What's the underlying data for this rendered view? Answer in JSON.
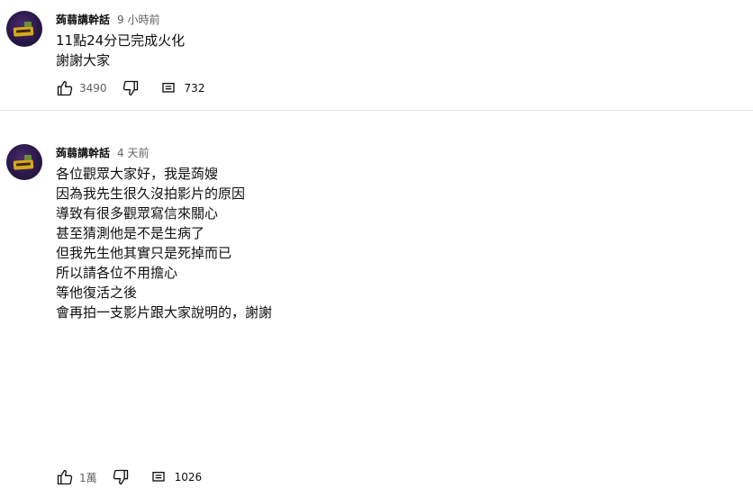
{
  "comments": [
    {
      "author": "蒟蒻講幹話",
      "time": "9 小時前",
      "lines": [
        "11點24分已完成火化",
        "謝謝大家"
      ],
      "likes": "3490",
      "replies": "732"
    },
    {
      "author": "蒟蒻講幹話",
      "time": "4 天前",
      "lines": [
        "各位觀眾大家好，我是蒟嫂",
        "因為我先生很久沒拍影片的原因",
        "導致有很多觀眾寫信來關心",
        "甚至猜測他是不是生病了",
        "但我先生他其實只是死掉而已",
        "所以請各位不用擔心",
        "等他復活之後",
        "會再拍一支影片跟大家說明的，謝謝"
      ],
      "likes": "1萬",
      "replies": "1026"
    }
  ],
  "icons": {
    "like": "thumbs-up-icon",
    "dislike": "thumbs-down-icon",
    "reply": "comment-icon"
  },
  "colors": {
    "text": "#0f0f0f",
    "secondary": "#606060",
    "divider": "#e5e5e5"
  }
}
